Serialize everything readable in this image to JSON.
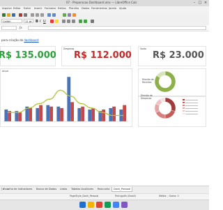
{
  "window": {
    "title": "07 - Preparacao Dashboard.xlsx — LibreOffice Calc"
  },
  "menu": [
    "Arquivo",
    "Editar",
    "Exibir",
    "Inserir",
    "Formatar",
    "Estilos",
    "Planilha",
    "Dados",
    "Ferramentas",
    "Janela",
    "Ajuda"
  ],
  "toolbar": {
    "font_name": "Calibri",
    "font_size": "11 pt"
  },
  "sheet": {
    "heading_prefix": "para criação do ",
    "heading_link": "dashboard"
  },
  "kpis": [
    {
      "label": "",
      "value": "R$ 135.000",
      "color": "#2ba13a"
    },
    {
      "label": "Despesas",
      "value": "R$ 112.000",
      "color": "#c62828"
    },
    {
      "label": "Saldo",
      "value": "R$ 23.000",
      "color": "#555555"
    }
  ],
  "bar_chart_label": "Anual",
  "chart_data": [
    {
      "type": "bar",
      "categories": [
        "1",
        "2",
        "3",
        "4",
        "5",
        "6",
        "7",
        "8",
        "9",
        "10",
        "11",
        "12"
      ],
      "series": [
        {
          "values": [
            8,
            7,
            10,
            9,
            11,
            10,
            30,
            9,
            8,
            7,
            9,
            8
          ],
          "color": "#4a72b4"
        },
        {
          "values": [
            7,
            6,
            9,
            11,
            10,
            9,
            13,
            10,
            9,
            8,
            10,
            11
          ],
          "color": "#c24a4a"
        },
        {
          "values": [
            6,
            6,
            9,
            12,
            15,
            21,
            17,
            12,
            9,
            6,
            4,
            4
          ],
          "color": "#b6c23a",
          "type": "line"
        }
      ],
      "ylim": [
        0,
        32
      ],
      "grid": false,
      "legend": "none"
    },
    {
      "type": "pie",
      "title": "Divisão de Receitas",
      "labels": [
        "",
        ""
      ],
      "values": [
        85,
        15
      ],
      "colors": [
        "#8db04a",
        "#d6e4b8"
      ]
    },
    {
      "type": "pie",
      "title": "Divisão de Despesas",
      "labels": [
        "",
        "",
        "",
        "",
        "",
        ""
      ],
      "values": [
        30,
        20,
        18,
        14,
        10,
        8
      ],
      "colors": [
        "#a13a3a",
        "#c45c5c",
        "#d88080",
        "#e6a3a3",
        "#f0c4c4",
        "#f8e0e0"
      ]
    }
  ],
  "tabs": {
    "items": [
      {
        "label": "Escolha de Indicadores"
      },
      {
        "label": "Banco de Dados"
      },
      {
        "label": "Listas"
      },
      {
        "label": "Tabelas Auxiliares"
      },
      {
        "label": "Rascunho"
      },
      {
        "label": "Dash_Pessoal"
      }
    ]
  },
  "status": {
    "page": "PageStyle_Dash_Pessoal",
    "language": "Português (Brasil)",
    "stats": "Média: ; Soma: 0"
  },
  "colors": {
    "accent_green": "#2ba13a",
    "accent_red": "#c62828"
  }
}
